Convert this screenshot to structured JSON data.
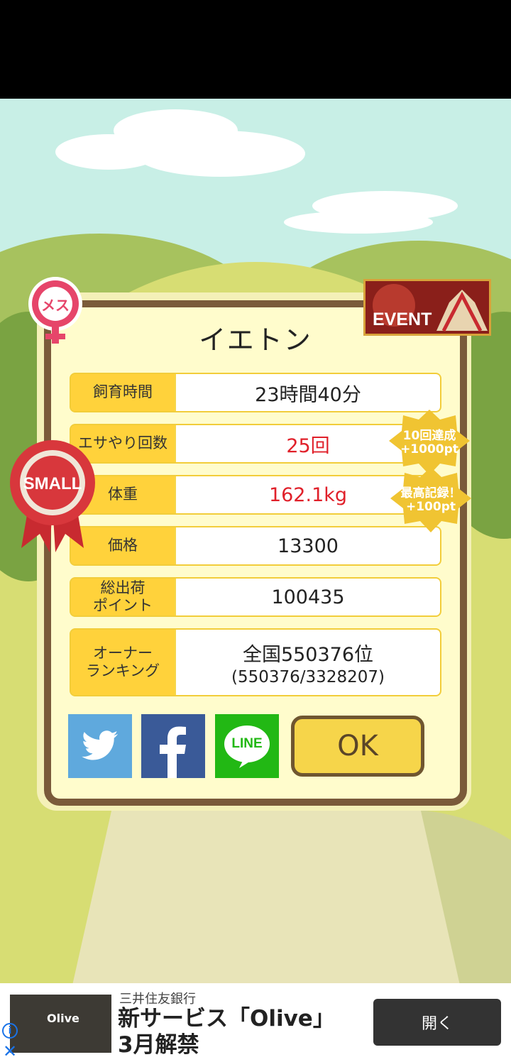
{
  "game": {
    "pig_name": "イエトン",
    "gender_badge": "メス",
    "size_badge": "SMALL",
    "event_badge": "EVENT",
    "stats": [
      {
        "label": "飼育時間",
        "value": "23時間40分",
        "highlight": false
      },
      {
        "label": "エサやり回数",
        "value": "25回",
        "highlight": true
      },
      {
        "label": "体重",
        "value": "162.1kg",
        "highlight": true
      },
      {
        "label": "価格",
        "value": "13300",
        "highlight": false
      },
      {
        "label": "総出荷\nポイント",
        "value": "100435",
        "highlight": false
      },
      {
        "label": "オーナー\nランキング",
        "value": "全国550376位",
        "sub": "(550376/3328207)",
        "highlight": false
      }
    ],
    "bonus_badges": [
      {
        "line1": "10回達成",
        "line2": "+1000pt"
      },
      {
        "line1": "最高記録！",
        "line2": "+100pt"
      }
    ],
    "share_buttons": [
      "twitter",
      "facebook",
      "LINE"
    ],
    "line_label": "LINE",
    "ok_label": "OK"
  },
  "ad": {
    "advertiser": "三井住友銀行",
    "headline_line1": "新サービス「Olive」",
    "headline_line2": "3月解禁",
    "thumb_logo": "Olive",
    "cta": "開く"
  },
  "colors": {
    "label_bg": "#ffd23b",
    "value_red": "#e0202a",
    "card_border": "#7a5a3a",
    "card_bg": "#fffccc"
  }
}
